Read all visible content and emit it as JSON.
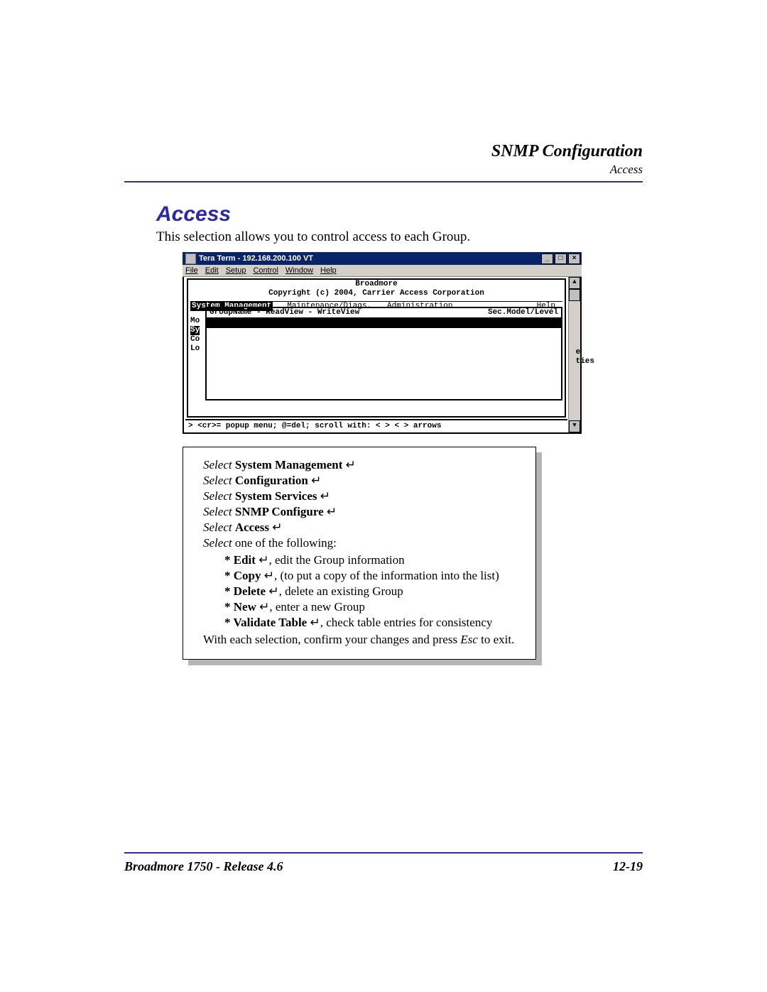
{
  "header": {
    "title": "SNMP Configuration",
    "subtitle": "Access"
  },
  "section": {
    "heading": "Access",
    "intro": "This selection allows you to control access to each Group."
  },
  "terminal": {
    "window_title": "Tera Term - 192.168.200.100 VT",
    "menus": {
      "file": "File",
      "edit": "Edit",
      "setup": "Setup",
      "control": "Control",
      "window": "Window",
      "help": "Help"
    },
    "winbtns": {
      "min": "_",
      "max": "□",
      "close": "×"
    },
    "banner1": "Broadmore",
    "banner2": "Copyright (c) 2004, Carrier Access Corporation",
    "topmenu": {
      "sysmgmt": "System Management",
      "maint": "Maintenance/Diags.",
      "admin": "Administration",
      "help": "Help"
    },
    "side": {
      "l1": "Mo",
      "l2": "Sy",
      "l3": "Co",
      "l4": "Lo"
    },
    "list_header_left": "GroupName - ReadView - WriteView",
    "list_header_right": "Sec.Model/Level",
    "right_frag": {
      "l1": "e",
      "l2": "ties"
    },
    "statusline": "> <cr>= popup menu; @=del; scroll with: < > < > arrows"
  },
  "instructions": {
    "select_word": "Select",
    "items": {
      "sysmgmt": "System Management",
      "config": "Configuration",
      "sysserv": "System Services",
      "snmp": "SNMP Configure",
      "access": "Access"
    },
    "one_of": " one of the following:",
    "opts": {
      "edit_b": "Edit",
      "edit_t": ", edit the Group information",
      "copy_b": "Copy",
      "copy_t": ", (to put a copy of the information into the list)",
      "del_b": "Delete",
      "del_t": ", delete an existing Group",
      "new_b": "New",
      "new_t": ", enter a new Group",
      "val_b": "Validate Table",
      "val_t": ", check table entries for consistency"
    },
    "confirm_a": "With each selection, confirm your changes and press ",
    "esc": "Esc",
    "confirm_b": " to exit."
  },
  "footer": {
    "left": "Broadmore 1750 - Release 4.6",
    "right": "12-19"
  },
  "enter_glyph": "↵"
}
